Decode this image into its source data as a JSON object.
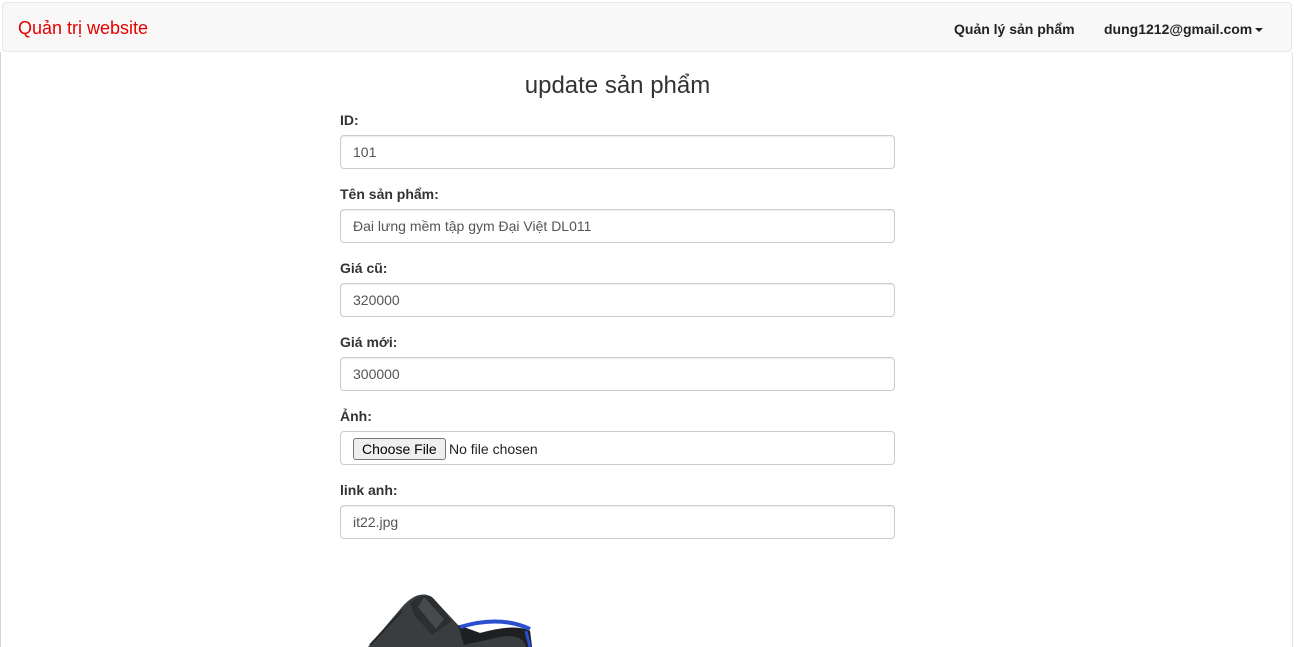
{
  "navbar": {
    "brand": "Quản trị website",
    "products_link": "Quản lý sản phẩm",
    "user_menu": "dung1212@gmail.com"
  },
  "form": {
    "title": "update sản phẩm",
    "id_label": "ID:",
    "id_value": "101",
    "name_label": "Tên sản phẩm:",
    "name_value": "Đai lưng mềm tập gym Đại Việt DL011",
    "old_price_label": "Giá cũ:",
    "old_price_value": "320000",
    "new_price_label": "Giá mới:",
    "new_price_value": "300000",
    "image_label": "Ảnh:",
    "file_button": "Choose File",
    "file_status": "No file chosen",
    "link_label": "link anh:",
    "link_value": "it22.jpg"
  },
  "colors": {
    "brand": "#e60000",
    "navbar_bg": "#f8f8f8"
  },
  "icons": {
    "user_menu_caret": "caret-down-icon"
  }
}
